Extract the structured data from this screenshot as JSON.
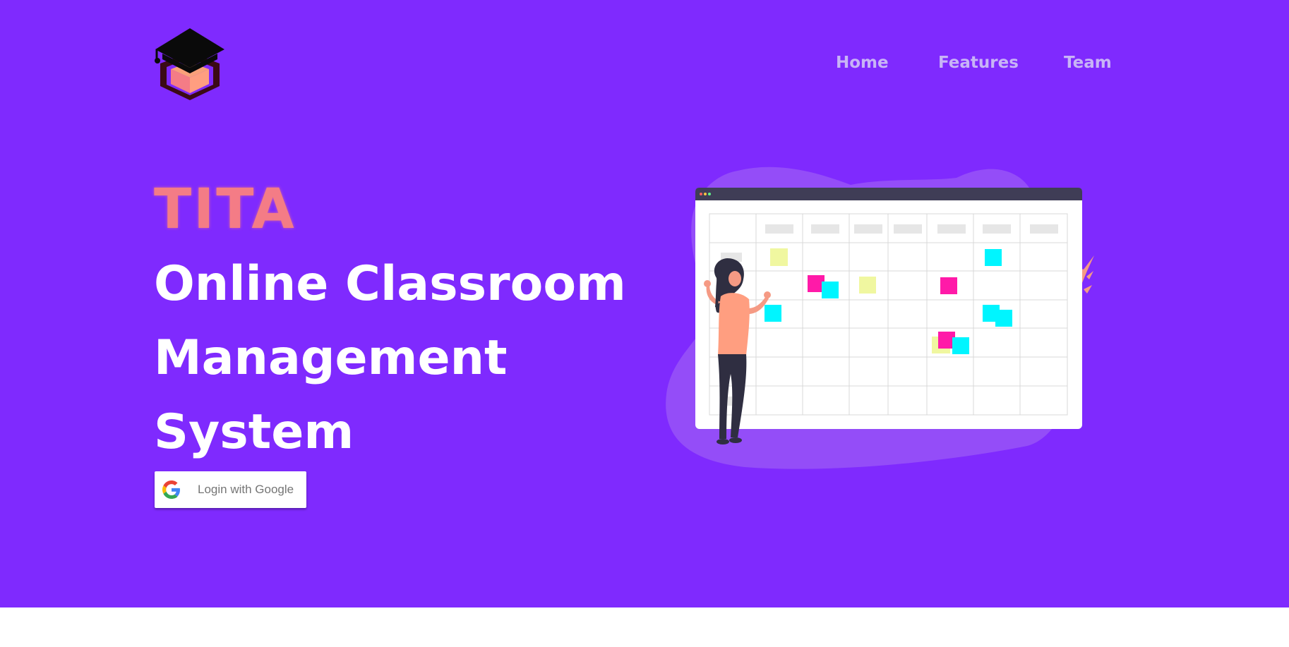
{
  "brand": {
    "name": "TITA",
    "logo_icon": "graduation-cap-logo-icon",
    "colors": {
      "primary": "#7f2afe",
      "brand_text": "#f47c86",
      "nav_text": "#c8b4f6"
    }
  },
  "nav": {
    "items": [
      {
        "label": "Home"
      },
      {
        "label": "Features"
      },
      {
        "label": "Team"
      }
    ]
  },
  "hero": {
    "headline_lines": [
      "Online Classroom",
      "Management",
      "System"
    ],
    "login_button": {
      "label": "Login with Google",
      "icon": "google-icon"
    },
    "illustration": "woman-at-calendar-board-illustration"
  }
}
